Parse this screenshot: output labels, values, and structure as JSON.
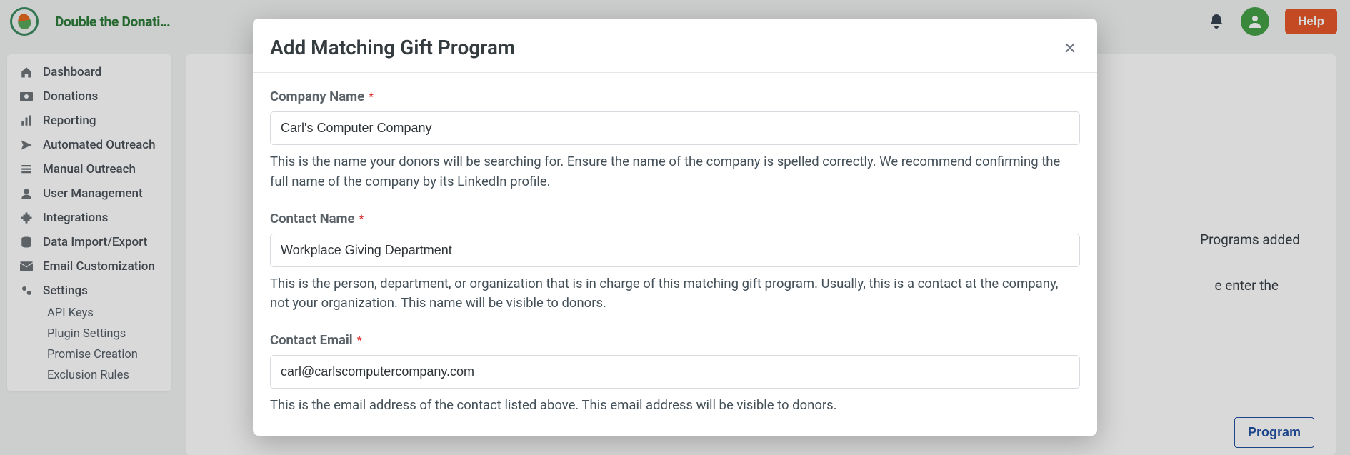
{
  "brand": {
    "name": "Double the Donati…"
  },
  "topbar": {
    "help_label": "Help"
  },
  "sidebar": {
    "items": [
      {
        "label": "Dashboard"
      },
      {
        "label": "Donations"
      },
      {
        "label": "Reporting"
      },
      {
        "label": "Automated Outreach"
      },
      {
        "label": "Manual Outreach"
      },
      {
        "label": "User Management"
      },
      {
        "label": "Integrations"
      },
      {
        "label": "Data Import/Export"
      },
      {
        "label": "Email Customization"
      },
      {
        "label": "Settings"
      }
    ],
    "sub_items": [
      {
        "label": "API Keys"
      },
      {
        "label": "Plugin Settings"
      },
      {
        "label": "Promise Creation"
      },
      {
        "label": "Exclusion Rules"
      }
    ]
  },
  "background_page": {
    "text_fragment_1": "Programs added",
    "text_fragment_2": "e enter the",
    "button_label_fragment": "Program"
  },
  "modal": {
    "title": "Add Matching Gift Program",
    "fields": {
      "company_name": {
        "label": "Company Name",
        "value": "Carl's Computer Company",
        "help": "This is the name your donors will be searching for. Ensure the name of the company is spelled correctly. We recommend confirming the full name of the company by its LinkedIn profile.",
        "required": "*"
      },
      "contact_name": {
        "label": "Contact Name",
        "value": "Workplace Giving Department",
        "help": "This is the person, department, or organization that is in charge of this matching gift program. Usually, this is a contact at the company, not your organization. This name will be visible to donors.",
        "required": "*"
      },
      "contact_email": {
        "label": "Contact Email",
        "value": "carl@carlscomputercompany.com",
        "help": "This is the email address of the contact listed above. This email address will be visible to donors.",
        "required": "*"
      }
    }
  }
}
